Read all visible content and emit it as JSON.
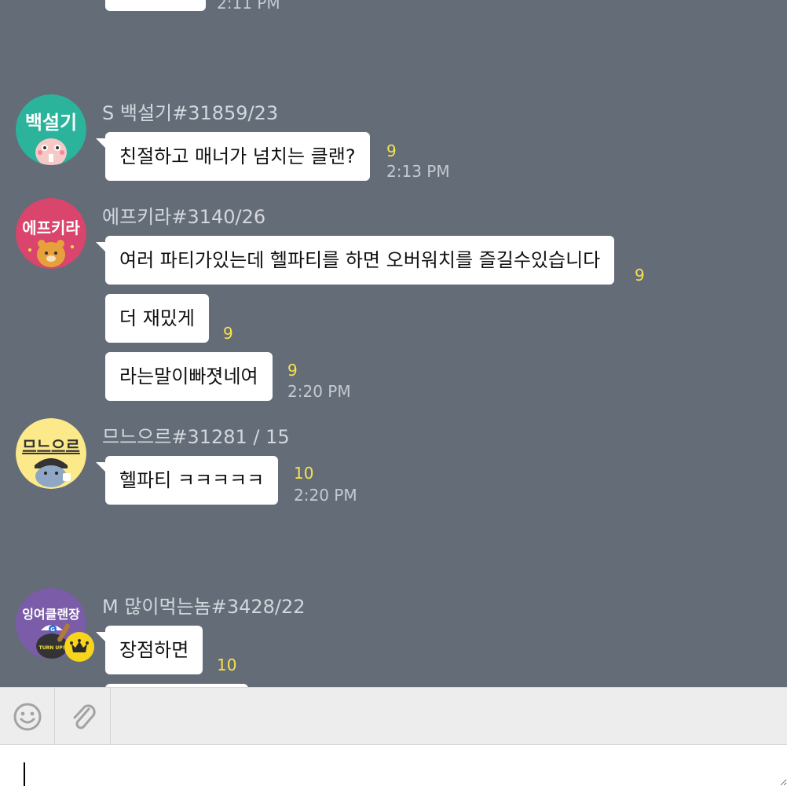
{
  "top_partial": {
    "time": "2:11 PM"
  },
  "messages": [
    {
      "avatar": {
        "label": "백설기",
        "bg": "#2bb39b"
      },
      "sender": "S 백설기#31859/23",
      "bubbles": [
        {
          "text": "친절하고 매너가 넘치는 클랜?",
          "count": "9",
          "time": "2:13 PM"
        }
      ]
    },
    {
      "avatar": {
        "label": "에프키라",
        "bg": "#d9456c"
      },
      "sender": "에프키라#3140/26",
      "bubbles": [
        {
          "text": "여러 파티가있는데 헬파티를 하면 오버워치를 즐길수있습니다",
          "count": "9"
        },
        {
          "text": "더 재밌게",
          "count": "9"
        },
        {
          "text": "라는말이빠졋네여",
          "count": "9",
          "time": "2:20 PM"
        }
      ]
    },
    {
      "avatar": {
        "label": "므느으르",
        "bg": "#fbe98a"
      },
      "sender": "므느으르#31281 / 15",
      "bubbles": [
        {
          "text": "헬파티 ㅋㅋㅋㅋㅋ",
          "count": "10",
          "time": "2:20 PM"
        }
      ]
    },
    {
      "avatar": {
        "label": "잉여클랜장",
        "bg": "#7a5ca8",
        "cap_letter": "G",
        "shirt_text": "TURN UP!"
      },
      "sender": "M 많이먹는놈#3428/22",
      "bubbles": [
        {
          "text": "장점하면",
          "count": "10"
        }
      ]
    }
  ],
  "toolbar": {
    "emoji_icon": "smiley-icon",
    "attach_icon": "paperclip-icon"
  },
  "input": {
    "value": ""
  },
  "colors": {
    "chat_bg": "#646c78",
    "unread": "#f7e24a",
    "time": "#c6cad1",
    "sender": "#d3d7dd",
    "crown_badge": "#f7d51d"
  }
}
